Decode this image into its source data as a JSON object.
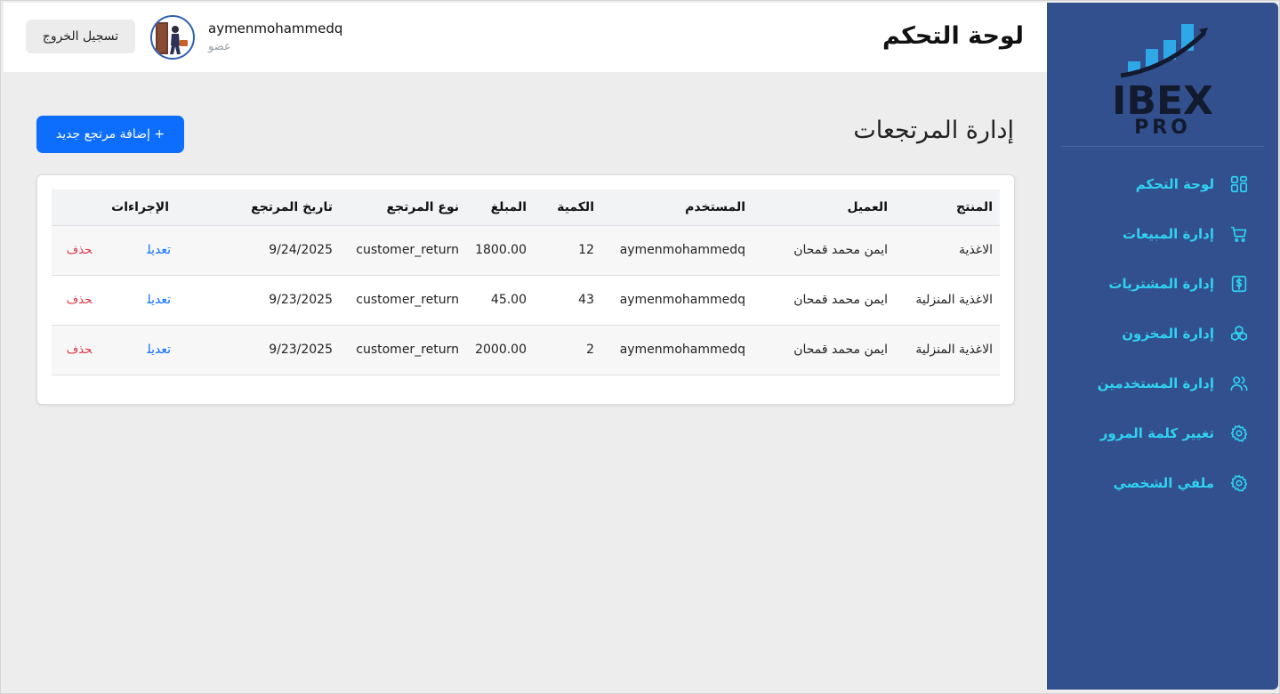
{
  "header": {
    "page_title": "لوحة التحكم",
    "user": {
      "name": "aymenmohammedq",
      "role": "عضو"
    },
    "logout_label": "تسجيل الخروج"
  },
  "main": {
    "section_title": "إدارة المرتجعات",
    "add_button_label": "+ إضافة مرتجع جديد",
    "table": {
      "columns": [
        "المنتج",
        "العميل",
        "المستخدم",
        "الكمية",
        "المبلغ",
        "نوع المرتجع",
        "تاريخ المرتجع",
        "الإجراءات"
      ],
      "rows": [
        {
          "product": "الاغذية",
          "customer": "ايمن محمد قمحان",
          "user": "aymenmohammedq",
          "quantity": "12",
          "amount": "1800.00",
          "type": "customer_return",
          "date": "9/24/2025",
          "edit": "تعديل",
          "delete": "حذف"
        },
        {
          "product": "الاغذية المنزلية",
          "customer": "ايمن محمد قمحان",
          "user": "aymenmohammedq",
          "quantity": "43",
          "amount": "45.00",
          "type": "customer_return",
          "date": "9/23/2025",
          "edit": "تعديل",
          "delete": "حذف"
        },
        {
          "product": "الاغذية المنزلية",
          "customer": "ايمن محمد قمحان",
          "user": "aymenmohammedq",
          "quantity": "2",
          "amount": "2000.00",
          "type": "customer_return",
          "date": "9/23/2025",
          "edit": "تعديل",
          "delete": "حذف"
        }
      ]
    }
  },
  "sidebar": {
    "logo": {
      "text": "IBEX",
      "sub": "PRO"
    },
    "items": [
      {
        "label": "لوحة التحكم",
        "icon": "dashboard-icon"
      },
      {
        "label": "إدارة المبيعات",
        "icon": "cart-icon"
      },
      {
        "label": "إدارة المشتريات",
        "icon": "dollar-receipt-icon"
      },
      {
        "label": "إدارة المخزون",
        "icon": "boxes-icon"
      },
      {
        "label": "إدارة المستخدمين",
        "icon": "users-icon"
      },
      {
        "label": "تغيير كلمة المرور",
        "icon": "gear-icon"
      },
      {
        "label": "ملفي الشخصي",
        "icon": "gear-icon"
      }
    ]
  },
  "colors": {
    "sidebar_bg": "#33508e",
    "nav_text": "#2fd2f2",
    "primary": "#0d6efd",
    "danger": "#dc3545"
  }
}
